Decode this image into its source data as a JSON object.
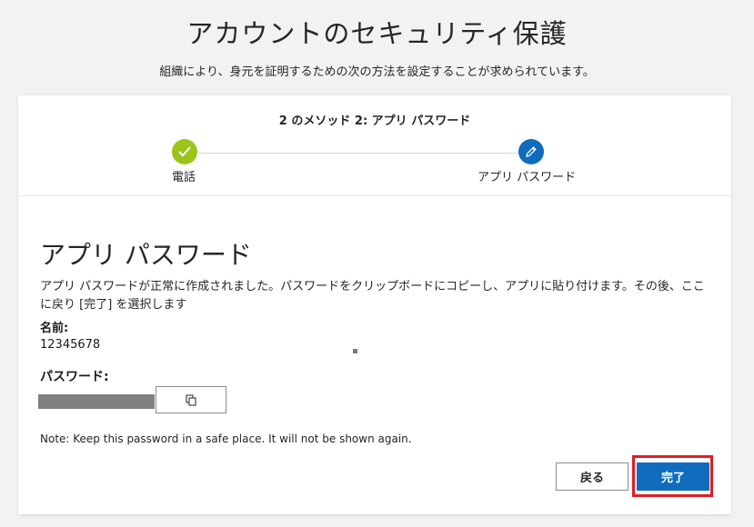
{
  "header": {
    "title": "アカウントのセキュリティ保護",
    "subtitle": "組織により、身元を証明するための次の方法を設定することが求められています。"
  },
  "steps": {
    "counter": "2 のメソッド 2: アプリ パスワード",
    "items": [
      {
        "label": "電話",
        "status": "complete",
        "icon": "check-icon",
        "color": "#9bc41a"
      },
      {
        "label": "アプリ パスワード",
        "status": "current",
        "icon": "pencil-icon",
        "color": "#0f6cbd"
      }
    ]
  },
  "main": {
    "title": "アプリ パスワード",
    "instructions": "アプリ パスワードが正常に作成されました。パスワードをクリップボードにコピーし、アプリに貼り付けます。その後、ここに戻り [完了] を選択します",
    "name_label": "名前:",
    "name_value": "12345678",
    "password_label": "パスワード:",
    "copy_icon": "copy-icon",
    "note": "Note: Keep this password in a safe place. It will not be shown again."
  },
  "buttons": {
    "back": "戻る",
    "done": "完了"
  },
  "colors": {
    "accent": "#0f6cbd",
    "success": "#9bc41a",
    "highlight": "#e31c23"
  }
}
